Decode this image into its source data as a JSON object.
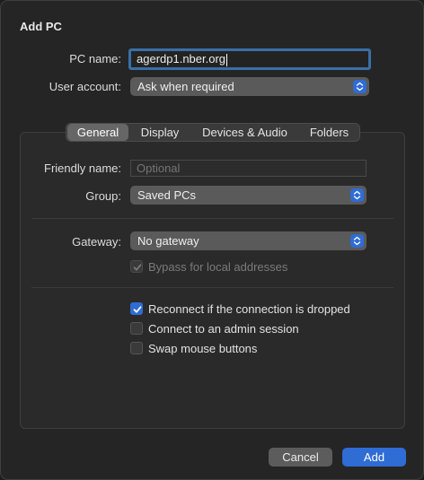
{
  "dialog": {
    "title": "Add PC"
  },
  "pc_name": {
    "label": "PC name:",
    "value": "agerdp1.nber.org"
  },
  "user_account": {
    "label": "User account:",
    "value": "Ask when required"
  },
  "tabs": [
    {
      "label": "General",
      "selected": true
    },
    {
      "label": "Display",
      "selected": false
    },
    {
      "label": "Devices & Audio",
      "selected": false
    },
    {
      "label": "Folders",
      "selected": false
    }
  ],
  "general": {
    "friendly_name": {
      "label": "Friendly name:",
      "placeholder": "Optional",
      "value": ""
    },
    "group": {
      "label": "Group:",
      "value": "Saved PCs"
    },
    "gateway": {
      "label": "Gateway:",
      "value": "No gateway"
    },
    "bypass": {
      "label": "Bypass for local addresses",
      "checked": true,
      "enabled": false
    },
    "reconnect": {
      "label": "Reconnect if the connection is dropped",
      "checked": true
    },
    "admin_session": {
      "label": "Connect to an admin session",
      "checked": false
    },
    "swap_mouse": {
      "label": "Swap mouse buttons",
      "checked": false
    }
  },
  "buttons": {
    "cancel": "Cancel",
    "add": "Add"
  },
  "colors": {
    "accent": "#2f6cd4",
    "background": "#252525"
  },
  "icons": {
    "popup": "chevron-up-down-icon",
    "check": "checkmark-icon"
  }
}
